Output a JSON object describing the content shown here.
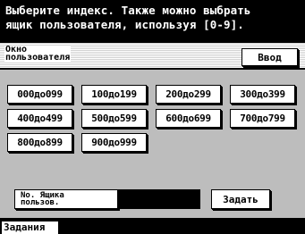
{
  "header": {
    "line1": "Выберите индекс. Также можно выбрать",
    "line2": "ящик пользователя, используя [0-9]."
  },
  "user_box": {
    "label_line1": "Окно",
    "label_line2": "пользователя",
    "input_button": "Ввод"
  },
  "index_buttons": [
    "000до099",
    "100до199",
    "200до299",
    "300до399",
    "400до499",
    "500до599",
    "600до699",
    "700до799",
    "800до899",
    "900до999"
  ],
  "box_number": {
    "button_line1": "No. Ящика",
    "button_line2": "пользов.",
    "value": ""
  },
  "set_button": "Задать",
  "bottom_tabs": {
    "jobs": "Задания"
  }
}
